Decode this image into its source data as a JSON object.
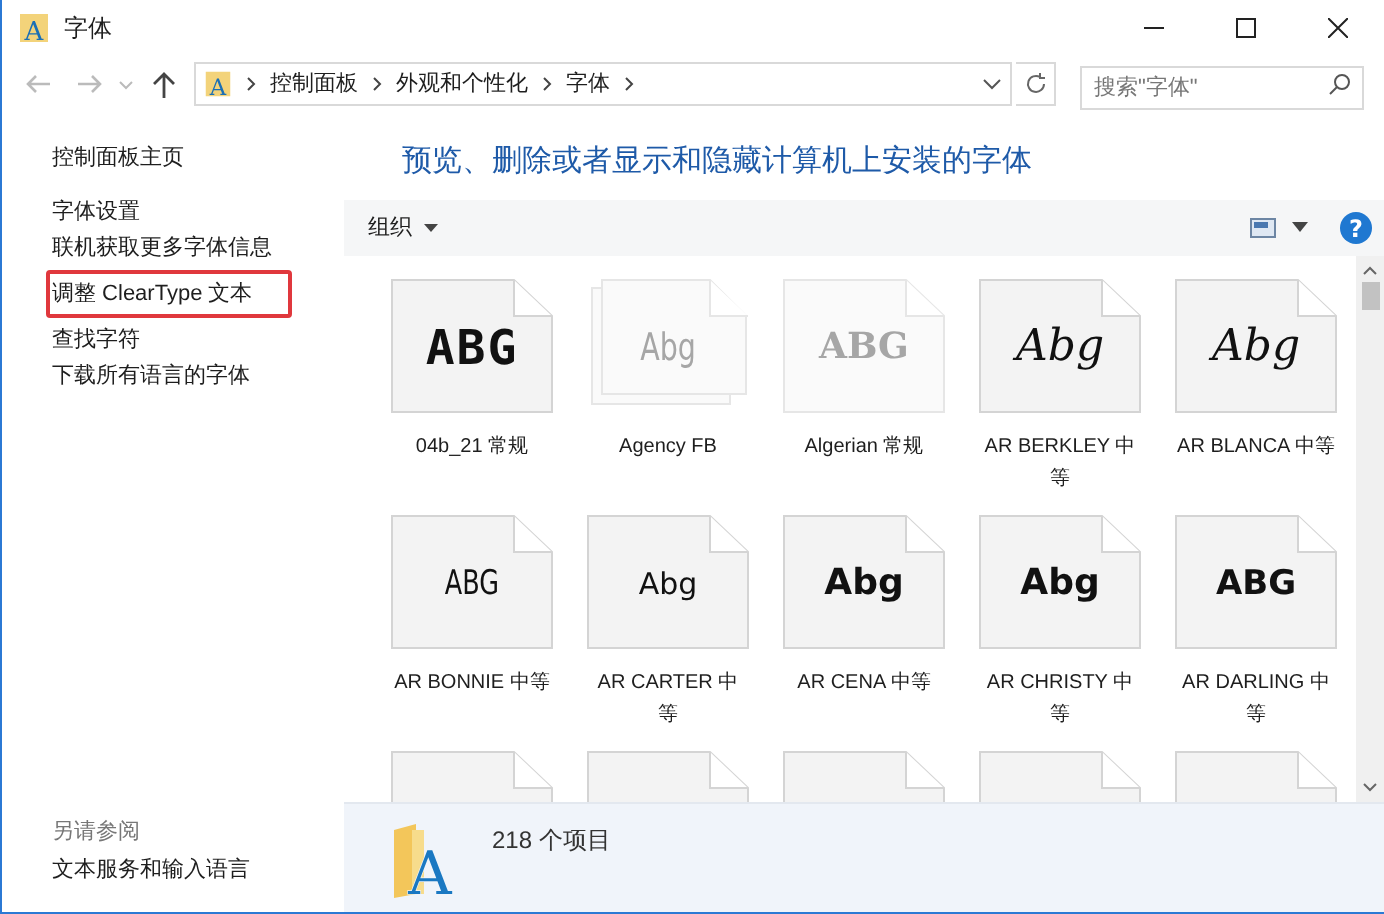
{
  "window": {
    "title": "字体",
    "icon_glyph": "A"
  },
  "address_bar": {
    "icon_glyph": "A",
    "crumbs": [
      "控制面板",
      "外观和个性化",
      "字体"
    ]
  },
  "search": {
    "placeholder": "搜索\"字体\""
  },
  "sidebar": {
    "home_link": "控制面板主页",
    "items": [
      {
        "label": "字体设置",
        "highlighted": false
      },
      {
        "label": "联机获取更多字体信息",
        "highlighted": false
      },
      {
        "label": "调整 ClearType 文本",
        "highlighted": true
      },
      {
        "label": "查找字符",
        "highlighted": false
      },
      {
        "label": "下载所有语言的字体",
        "highlighted": false
      }
    ],
    "see_also": {
      "heading": "另请参阅",
      "links": [
        "文本服务和输入语言"
      ]
    }
  },
  "heading": "预览、删除或者显示和隐藏计算机上安装的字体",
  "toolbar": {
    "organize": "组织",
    "help_glyph": "?"
  },
  "fonts": [
    {
      "label": "04b_21 常规",
      "sample": "ABG",
      "kind": "pixel",
      "hidden": false,
      "family": false
    },
    {
      "label": "Agency FB",
      "sample": "Abg",
      "kind": "condensed",
      "hidden": true,
      "family": true
    },
    {
      "label": "Algerian 常规",
      "sample": "ABG",
      "kind": "decorative",
      "hidden": true,
      "family": false
    },
    {
      "label": "AR BERKLEY 中等",
      "sample": "Abg",
      "kind": "script",
      "hidden": false,
      "family": false
    },
    {
      "label": "AR BLANCA 中等",
      "sample": "Abg",
      "kind": "script",
      "hidden": false,
      "family": false
    },
    {
      "label": "AR BONNIE 中等",
      "sample": "ABG",
      "kind": "thin",
      "hidden": false,
      "family": false
    },
    {
      "label": "AR CARTER 中等",
      "sample": "Abg",
      "kind": "hand",
      "hidden": false,
      "family": false
    },
    {
      "label": "AR CENA 中等",
      "sample": "Abg",
      "kind": "bold",
      "hidden": false,
      "family": false
    },
    {
      "label": "AR CHRISTY 中等",
      "sample": "Abg",
      "kind": "bold",
      "hidden": false,
      "family": false
    },
    {
      "label": "AR DARLING 中等",
      "sample": "ABG",
      "kind": "caps",
      "hidden": false,
      "family": false
    },
    {
      "kind": "blank",
      "hidden": false,
      "family": false
    },
    {
      "kind": "blank",
      "hidden": false,
      "family": false
    },
    {
      "kind": "blank",
      "hidden": false,
      "family": false
    },
    {
      "kind": "blank",
      "hidden": false,
      "family": false
    },
    {
      "kind": "blank",
      "hidden": false,
      "family": false
    }
  ],
  "status_bar": {
    "icon_glyph": "A",
    "count": "218 个项目"
  }
}
